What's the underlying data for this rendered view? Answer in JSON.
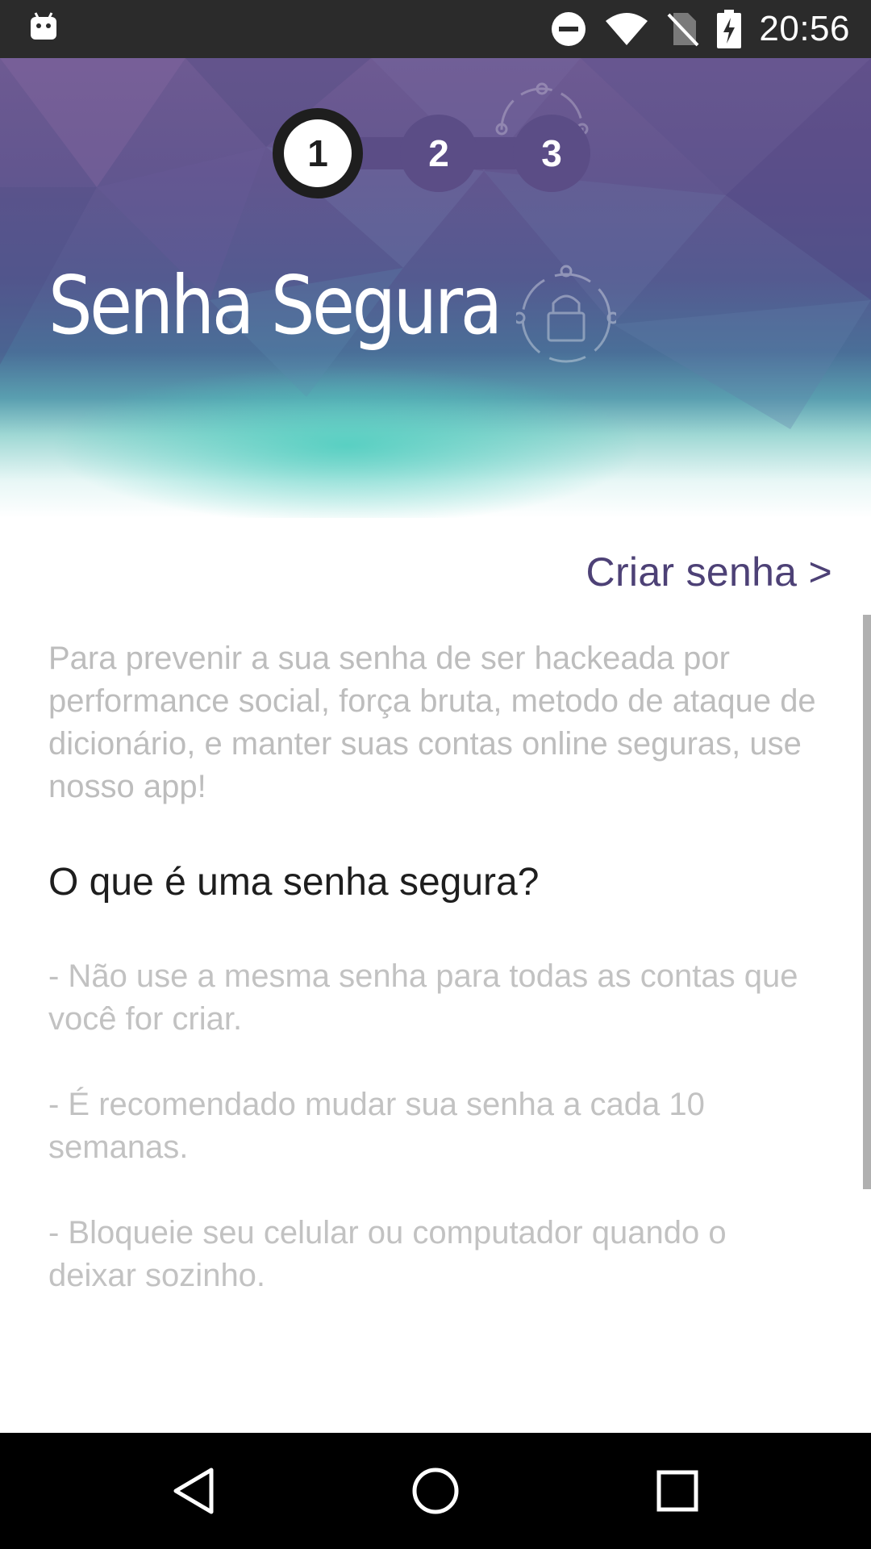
{
  "status_bar": {
    "time": "20:56",
    "icons": [
      "android-notification-icon",
      "do-not-disturb-icon",
      "wifi-icon",
      "no-sim-icon",
      "battery-charging-icon"
    ]
  },
  "header": {
    "steps": [
      "1",
      "2",
      "3"
    ],
    "active_step": "1",
    "title": "Senha Segura"
  },
  "content": {
    "create_link": "Criar senha >",
    "intro": "Para prevenir a sua senha de ser hackeada por performance social, força bruta, metodo de ataque de dicionário, e manter suas contas online seguras, use nosso app!",
    "heading": "O que é uma senha segura?",
    "tips": [
      "- Não use a mesma senha para todas as contas que você for criar.",
      "- É recomendado mudar sua senha a cada 10 semanas.",
      "- Bloqueie seu celular ou computador quando o deixar sozinho."
    ]
  },
  "navigation": {
    "buttons": [
      "back-icon",
      "home-icon",
      "recents-icon"
    ]
  },
  "colors": {
    "accent": "#4d4176",
    "step": "#5b4d86",
    "muted_text": "#bdbdbd",
    "heading_text": "#1e1e1e"
  }
}
